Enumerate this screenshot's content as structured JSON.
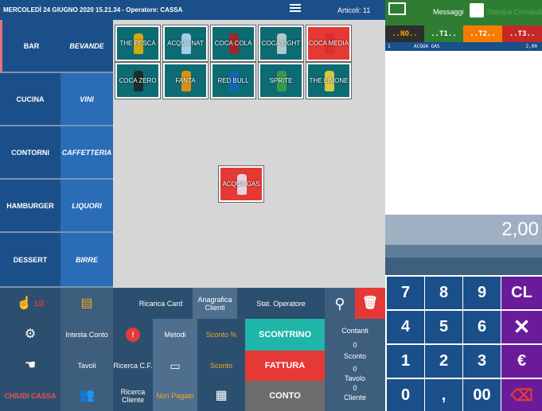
{
  "topbar": {
    "title": "MERCOLEDÌ 24 GIUGNO 2020 15.21.34  -  Operatore: CASSA",
    "articoli": "Articoli: 11"
  },
  "header": {
    "messages_label": "Messaggi",
    "print_label": "Stampa Comanda"
  },
  "tabs": [
    "..NO..",
    "..T1..",
    "..T2..",
    "..T3.."
  ],
  "receipt": {
    "lines": [
      {
        "qty": "1",
        "desc": "ACQUA GAS",
        "price": "2,00"
      }
    ],
    "total": "2,00"
  },
  "categories": [
    "BAR",
    "CUCINA",
    "CONTORNI",
    "HAMBURGER",
    "DESSERT"
  ],
  "subcategories": [
    "BEVANDE",
    "VINI",
    "CAFFETTERIA",
    "LIQUORI",
    "BIRRE"
  ],
  "products": [
    {
      "label": "THE PESCA",
      "color": "#f4b400"
    },
    {
      "label": "ACQUA NAT",
      "color": "#bbdefb"
    },
    {
      "label": "COCA COLA",
      "color": "#b71c1c"
    },
    {
      "label": "COCA LIGHT",
      "color": "#cfd8dc"
    },
    {
      "label": "COCA MEDIA",
      "color": "#d32f2f"
    },
    {
      "label": "COCA ZERO",
      "color": "#212121"
    },
    {
      "label": "FANTA",
      "color": "#ff9800"
    },
    {
      "label": "RED BULL",
      "color": "#1565c0"
    },
    {
      "label": "SPRITE",
      "color": "#43a047"
    },
    {
      "label": "THE LIMONE",
      "color": "#fdd835"
    }
  ],
  "selected_product": "ACQUA GAS",
  "keypad": [
    "7",
    "8",
    "9",
    "CL",
    "4",
    "5",
    "6",
    "✕",
    "1",
    "2",
    "3",
    "€",
    "0",
    ",",
    "00",
    "⌫"
  ],
  "functions": {
    "page_indicator": "1/2",
    "ricarica_card": "Ricarica Card",
    "anagrafica_clienti": "Anagrafica Clienti",
    "stat_operatore": "Stat. Operatore",
    "intesta_conto": "Intesta Conto",
    "metodi": "Metodi",
    "sconto_perc": "Sconto %",
    "scontrino": "SCONTRINO",
    "contanti_label": "Contanti",
    "contanti_value": "0",
    "tavoli": "Tavoli",
    "ricerca_cf": "Ricerca C.F.",
    "sconto": "Sconto",
    "fattura": "FATTURA",
    "sconto_label": "Sconto",
    "sconto_value": "0",
    "tavolo_label": "Tavolo",
    "chiudi_cassa": "CHIUDI CASSA",
    "ricerca_cliente": "Ricerca Cliente",
    "non_pagato": "Non Pagato",
    "conto": "CONTO",
    "cliente_value": "0",
    "cliente_label": "Cliente"
  },
  "colors": {
    "primary": "#1a4f8a",
    "accent_teal": "#1fb5a8",
    "accent_red": "#e53935"
  }
}
